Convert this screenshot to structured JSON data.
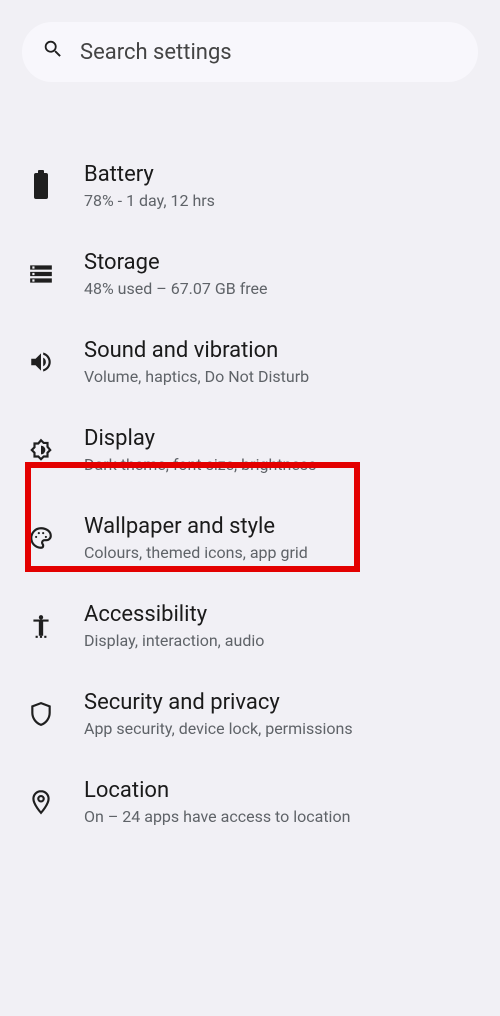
{
  "search": {
    "placeholder": "Search settings"
  },
  "items": [
    {
      "key": "battery",
      "title": "Battery",
      "subtitle": "78% - 1 day, 12 hrs"
    },
    {
      "key": "storage",
      "title": "Storage",
      "subtitle": "48% used – 67.07 GB free"
    },
    {
      "key": "sound",
      "title": "Sound and vibration",
      "subtitle": "Volume, haptics, Do Not Disturb"
    },
    {
      "key": "display",
      "title": "Display",
      "subtitle": "Dark theme, font size, brightness"
    },
    {
      "key": "wallpaper",
      "title": "Wallpaper and style",
      "subtitle": "Colours, themed icons, app grid"
    },
    {
      "key": "accessibility",
      "title": "Accessibility",
      "subtitle": "Display, interaction, audio"
    },
    {
      "key": "security",
      "title": "Security and privacy",
      "subtitle": "App security, device lock, permissions"
    },
    {
      "key": "location",
      "title": "Location",
      "subtitle": "On – 24 apps have access to location"
    }
  ]
}
